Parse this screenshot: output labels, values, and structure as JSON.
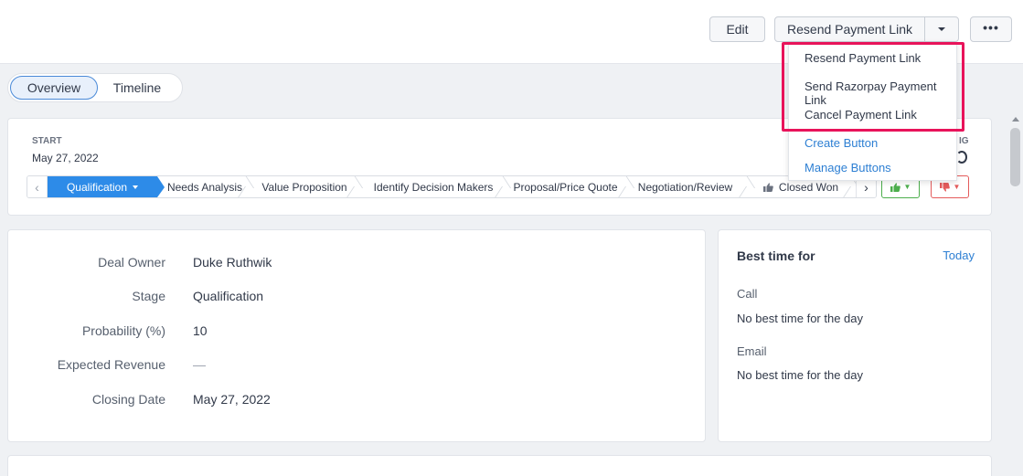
{
  "toolbar": {
    "edit_label": "Edit",
    "resend_label": "Resend Payment Link",
    "more_label": "•••"
  },
  "tabs": [
    {
      "label": "Overview",
      "active": true
    },
    {
      "label": "Timeline",
      "active": false
    }
  ],
  "stage_card": {
    "start_label": "START",
    "start_date": "May 27, 2022",
    "closing_fragment": "IG",
    "stages": [
      {
        "label": "Qualification",
        "active": true
      },
      {
        "label": "Needs Analysis"
      },
      {
        "label": "Value Proposition"
      },
      {
        "label": "Identify Decision Makers"
      },
      {
        "label": "Proposal/Price Quote"
      },
      {
        "label": "Negotiation/Review"
      },
      {
        "label": "Closed Won",
        "icon": "thumbs-up-icon"
      }
    ],
    "vote_up_icon": "thumbs-up-icon",
    "vote_down_icon": "thumbs-down-icon"
  },
  "details": {
    "fields": [
      {
        "label": "Deal Owner",
        "value": "Duke Ruthwik"
      },
      {
        "label": "Stage",
        "value": "Qualification"
      },
      {
        "label": "Probability (%)",
        "value": "10"
      },
      {
        "label": "Expected Revenue",
        "value": "—"
      },
      {
        "label": "Closing Date",
        "value": "May 27, 2022"
      }
    ]
  },
  "best_time": {
    "title": "Best time for",
    "today_label": "Today",
    "call_label": "Call",
    "call_value": "No best time for the day",
    "email_label": "Email",
    "email_value": "No best time for the day"
  },
  "dropdown": {
    "items": [
      {
        "label": "Resend Payment Link"
      },
      {
        "label": "Send Razorpay Payment Link"
      },
      {
        "label": "Cancel Payment Link"
      },
      {
        "label": "Create Button"
      },
      {
        "label": "Manage Buttons"
      }
    ]
  },
  "colors": {
    "accent": "#2d8be8",
    "highlight": "#e8135a",
    "link": "#2d7fd3",
    "vote_up": "#4cae4c",
    "vote_down": "#e45b5b"
  }
}
